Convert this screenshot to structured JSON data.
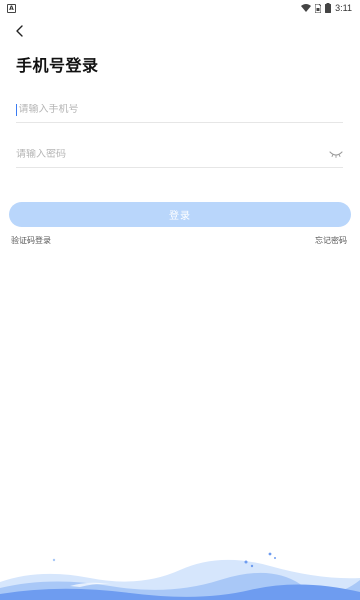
{
  "status_bar": {
    "app_badge": "A",
    "time": "3:11"
  },
  "header": {
    "title": "手机号登录"
  },
  "form": {
    "phone_placeholder": "请输入手机号",
    "password_placeholder": "请输入密码",
    "login_label": "登录",
    "sms_login_label": "验证码登录",
    "forgot_password_label": "忘记密码"
  },
  "colors": {
    "accent": "#3a7bf2",
    "button_disabled": "#b9d6fb",
    "wave_light": "#d6e6fc",
    "wave_mid": "#a9c8f7",
    "wave_dark": "#6e9cf0"
  },
  "icons": {
    "back": "chevron-left-icon",
    "eye": "eye-closed-icon",
    "wifi": "wifi-icon",
    "sim": "sim-icon",
    "battery": "battery-icon"
  }
}
